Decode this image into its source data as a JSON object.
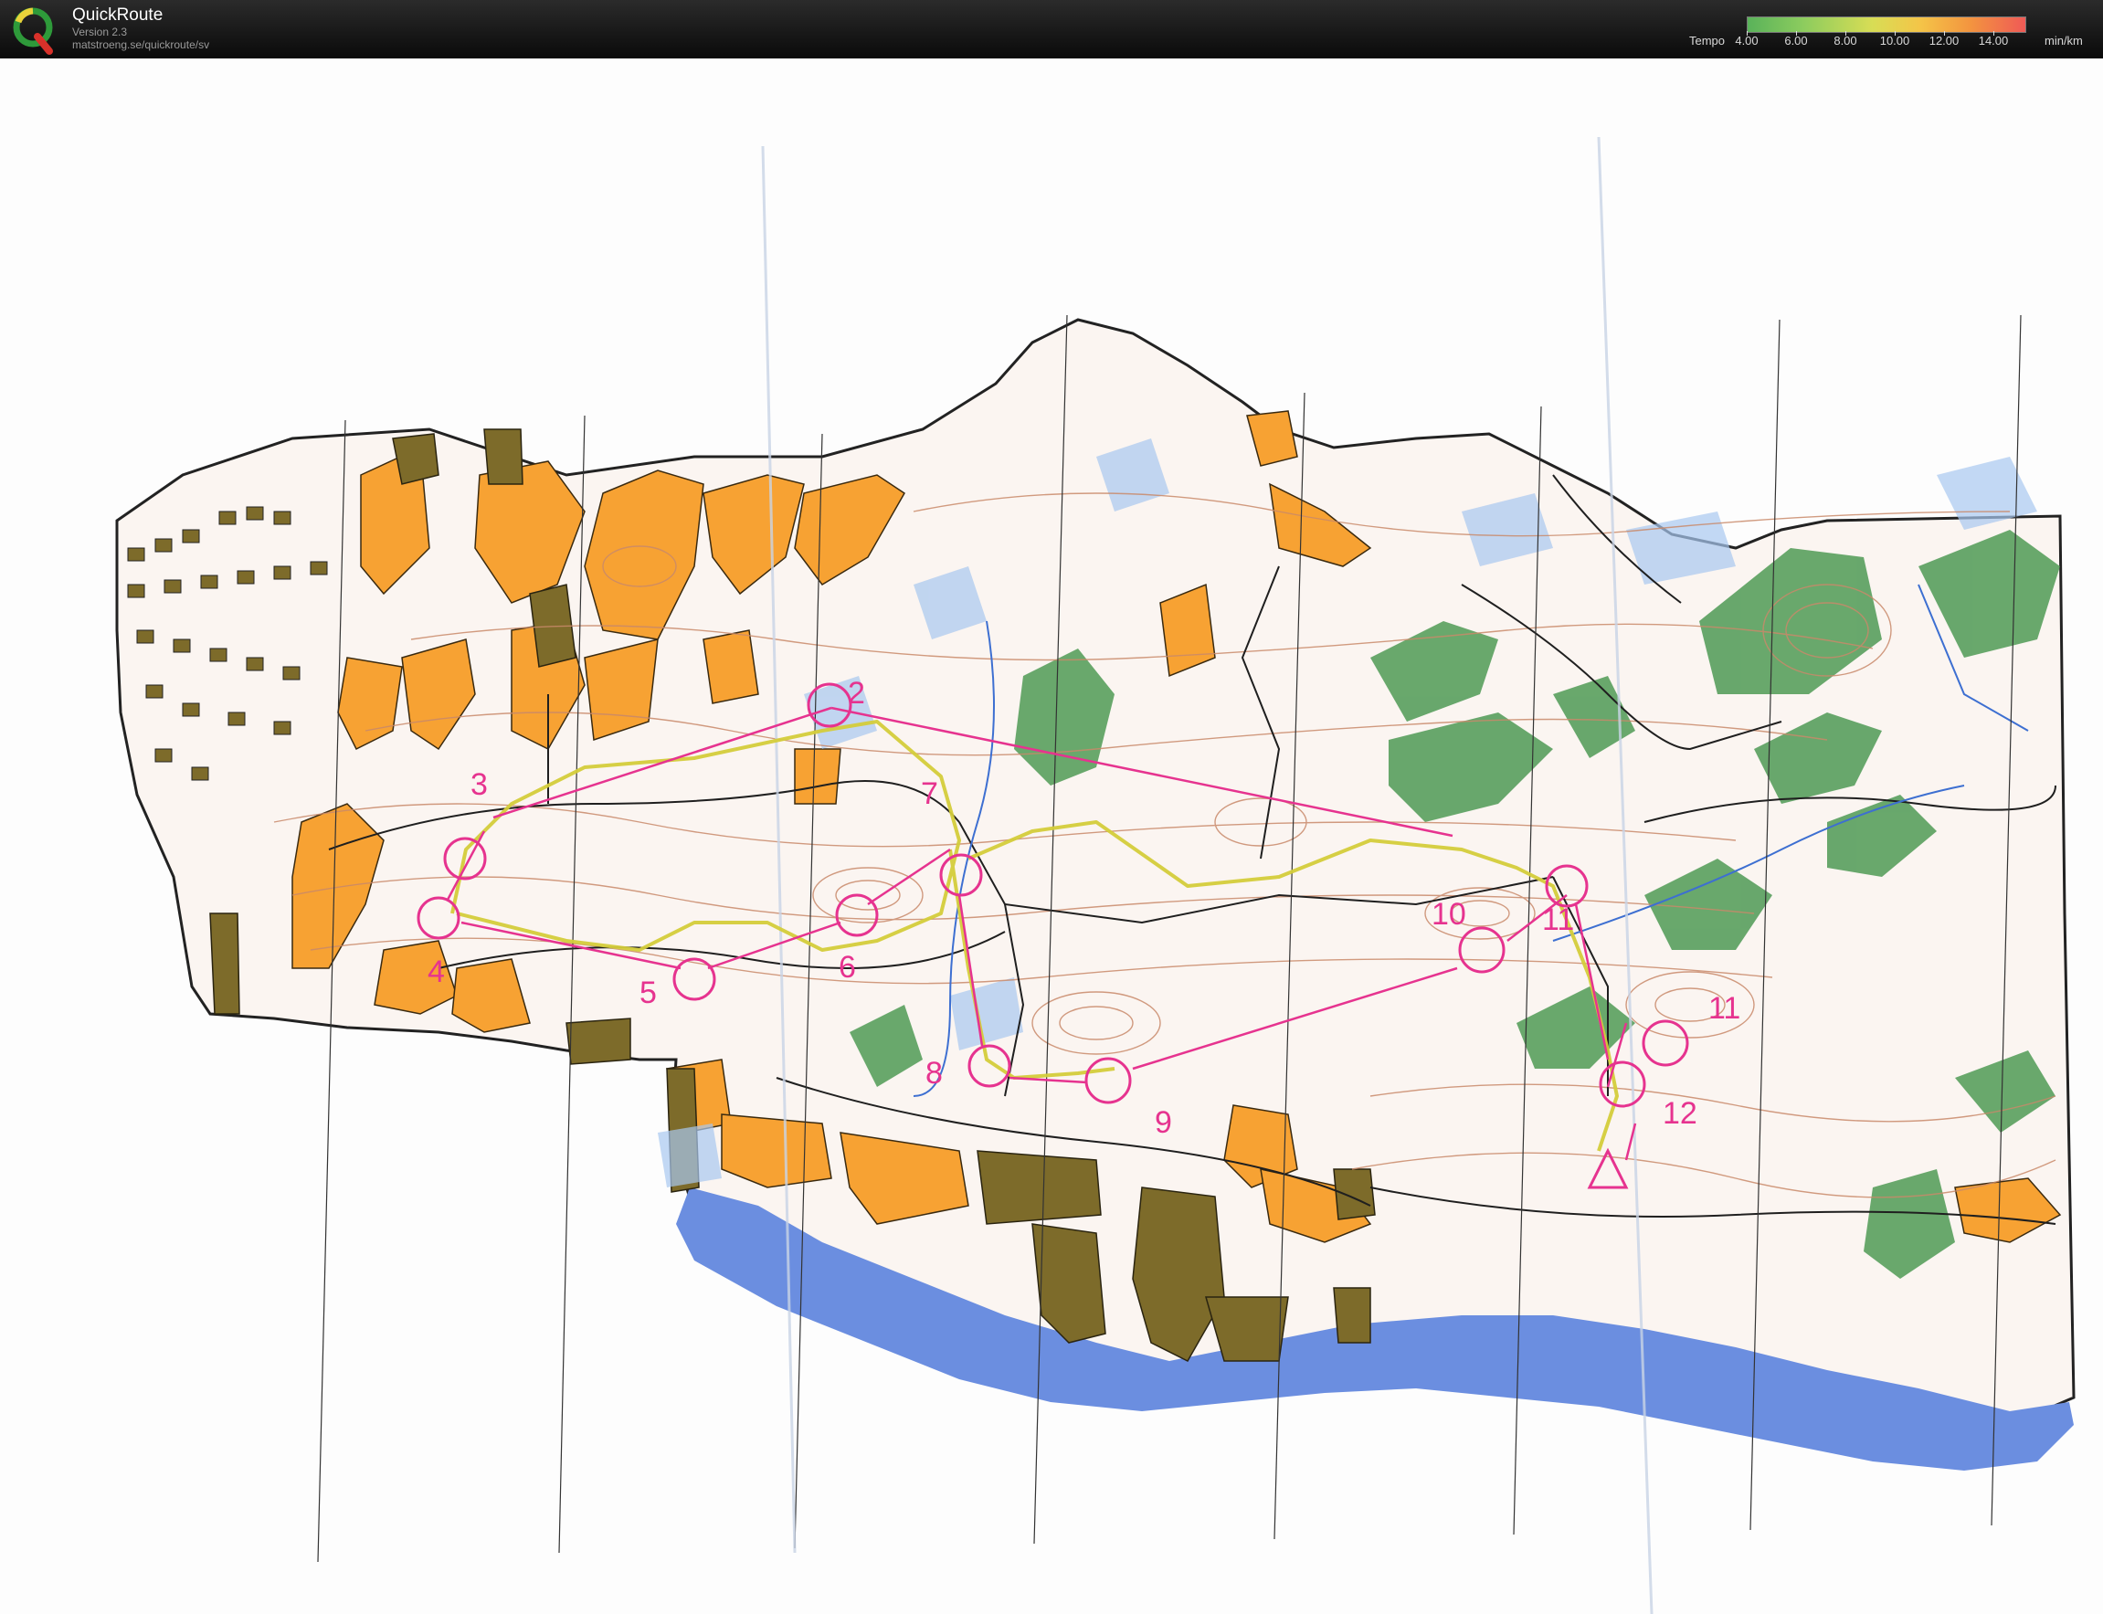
{
  "app": {
    "title": "QuickRoute",
    "version": "Version 2.3",
    "url": "matstroeng.se/quickroute/sv"
  },
  "legend": {
    "label": "Tempo",
    "unit": "min/km",
    "ticks": [
      "4.00",
      "6.00",
      "8.00",
      "10.00",
      "12.00",
      "14.00"
    ]
  },
  "course": {
    "control_labels": [
      "2",
      "3",
      "4",
      "5",
      "6",
      "7",
      "8",
      "9",
      "10",
      "11",
      "11",
      "12"
    ]
  },
  "colors": {
    "open_land": "#f7a233",
    "settlement": "#7d6b2a",
    "water": "#6b8ee0",
    "green_vegetation": "#4f9a55",
    "course_overprint": "#e6338f",
    "route": "#d4cc3a"
  }
}
